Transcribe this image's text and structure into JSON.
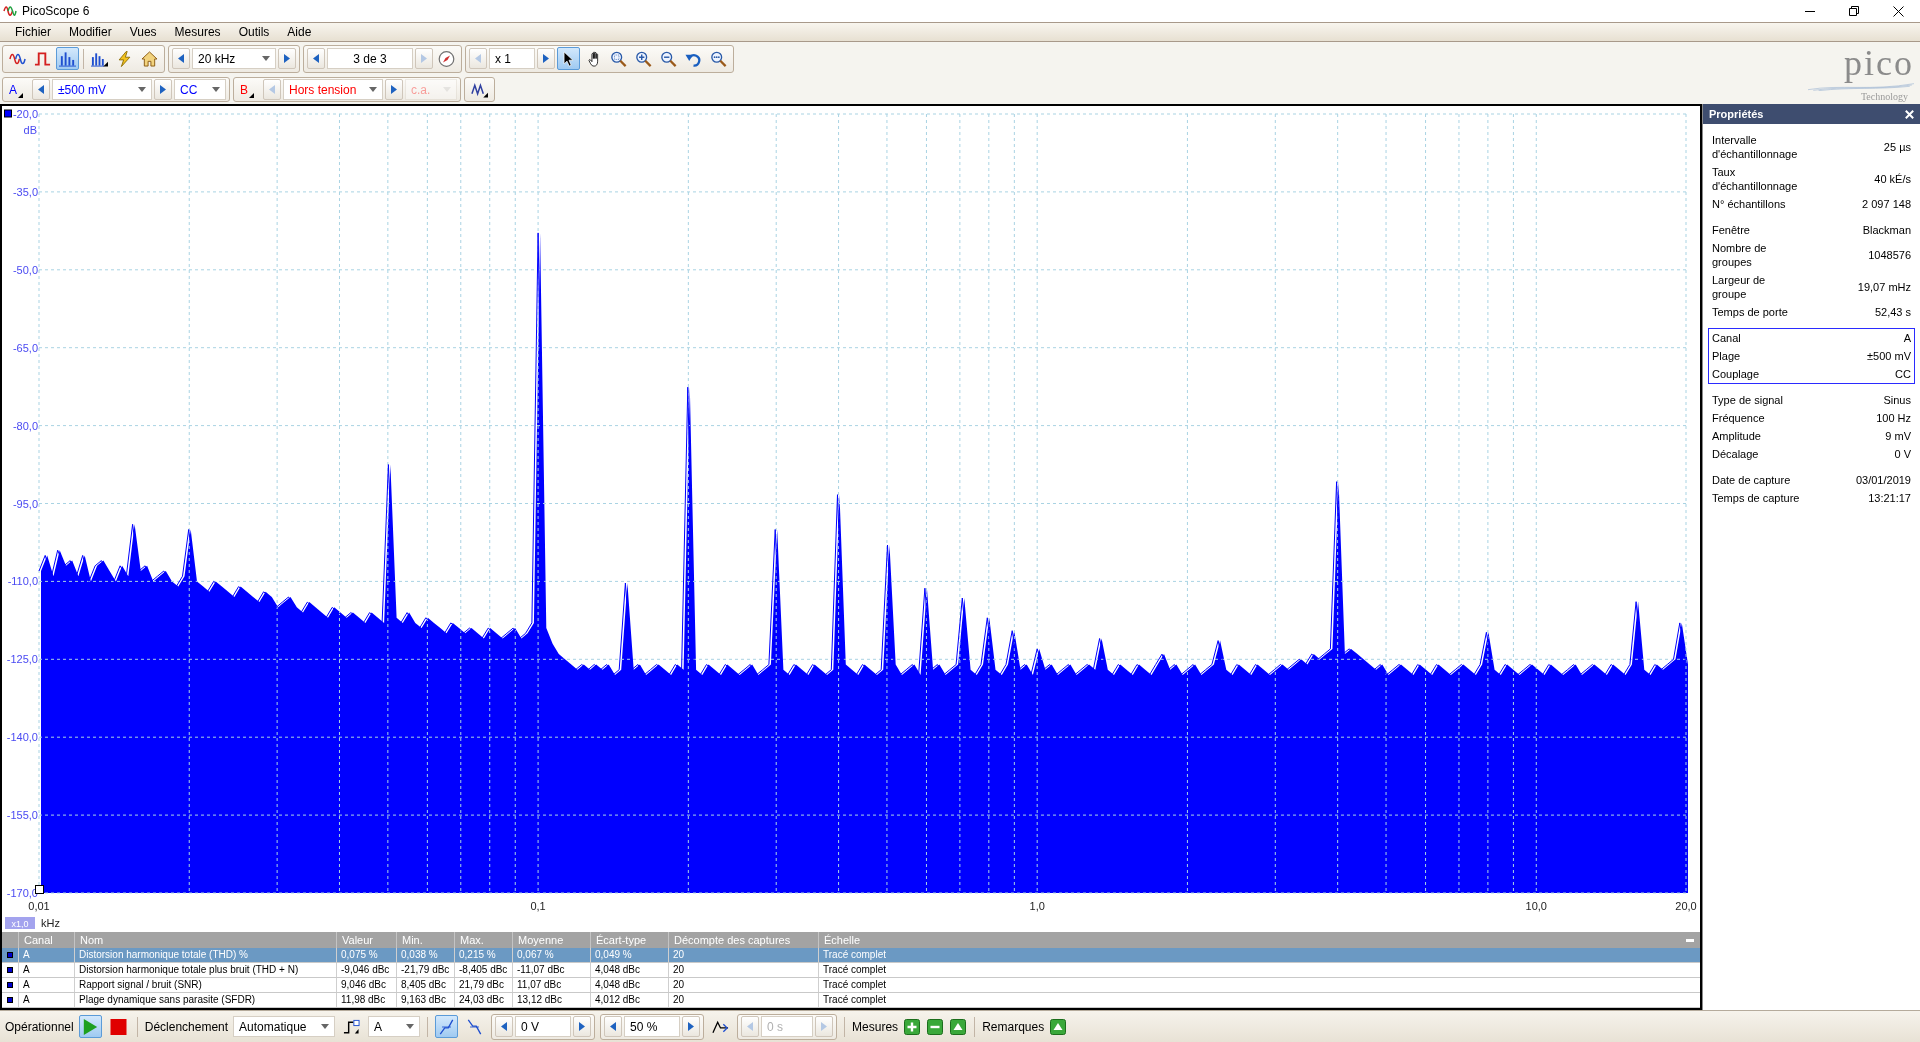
{
  "window": {
    "title": "PicoScope 6"
  },
  "menu": [
    {
      "label": "Fichier"
    },
    {
      "label": "Modifier"
    },
    {
      "label": "Vues"
    },
    {
      "label": "Mesures"
    },
    {
      "label": "Outils"
    },
    {
      "label": "Aide"
    }
  ],
  "toolbar": {
    "modes": [
      {
        "kind": "scope",
        "selected": false
      },
      {
        "kind": "persistence",
        "selected": false
      },
      {
        "kind": "spectrum",
        "selected": true
      }
    ],
    "actions": [
      {
        "kind": "spectrum_options"
      },
      {
        "kind": "auto_setup"
      },
      {
        "kind": "default_setup"
      }
    ],
    "timebase": {
      "value": "20 kHz",
      "prev_disabled": false,
      "next_disabled": false
    },
    "buffer": {
      "value": "3 de 3",
      "prev_disabled": false,
      "next_disabled": true
    },
    "zoom": {
      "value": "x 1",
      "prev_disabled": true,
      "next_disabled": false
    },
    "tools": [
      {
        "kind": "pointer",
        "selected": true
      },
      {
        "kind": "hand",
        "selected": false
      },
      {
        "kind": "zoom_area",
        "selected": false
      },
      {
        "kind": "zoom_in",
        "selected": false
      },
      {
        "kind": "zoom_out",
        "selected": false
      },
      {
        "kind": "undo_zoom",
        "selected": false
      },
      {
        "kind": "zoom_fit",
        "selected": false
      }
    ]
  },
  "channel_bar": {
    "channels": [
      {
        "label": "A",
        "color": "#0000ff",
        "range": {
          "value": "±500 mV",
          "prev_disabled": false,
          "next_disabled": false
        },
        "coupling": {
          "value": "CC",
          "disabled": false
        }
      },
      {
        "label": "B",
        "color": "#ff0000",
        "range": {
          "value": "Hors tension",
          "prev_disabled": true,
          "next_disabled": false
        },
        "coupling": {
          "value": "c.a.",
          "disabled": true
        }
      }
    ]
  },
  "logo": {
    "wordmark": "pico",
    "tagline": "Technology"
  },
  "chart": {
    "zoom_badge": "x1,0",
    "chart_data": {
      "type": "line",
      "xlabel": "kHz",
      "ylabel": "dB",
      "grid": true,
      "categories": [
        "0,01",
        null,
        null,
        null,
        null,
        null,
        null,
        null,
        null,
        null,
        null,
        null,
        null,
        null,
        null,
        null,
        null,
        null,
        null,
        null,
        null,
        null,
        null,
        null,
        null,
        null,
        null,
        null,
        null,
        null,
        null,
        null,
        null,
        null,
        null,
        null,
        null,
        null,
        null,
        null,
        null,
        null,
        null,
        null,
        null,
        null,
        null,
        null,
        null,
        null,
        null,
        null,
        null,
        null,
        null,
        null,
        null,
        null,
        null,
        null,
        null,
        null,
        null,
        null,
        null,
        null,
        null,
        null,
        null,
        null,
        null,
        null,
        null,
        null,
        null,
        null,
        null,
        null,
        null,
        null,
        "0,1",
        null,
        null,
        null,
        null,
        null,
        null,
        null,
        null,
        null,
        null,
        null,
        null,
        null,
        null,
        null,
        null,
        null,
        null,
        null,
        null,
        null,
        null,
        null,
        null,
        null,
        null,
        null,
        null,
        null,
        null,
        null,
        null,
        null,
        null,
        null,
        null,
        null,
        null,
        null,
        null,
        null,
        null,
        null,
        null,
        null,
        null,
        null,
        null,
        null,
        null,
        null,
        null,
        null,
        null,
        null,
        null,
        null,
        null,
        null,
        null,
        null,
        null,
        null,
        null,
        null,
        null,
        null,
        null,
        null,
        null,
        null,
        null,
        null,
        null,
        null,
        null,
        null,
        null,
        null,
        "1,0",
        null,
        null,
        null,
        null,
        null,
        null,
        null,
        null,
        null,
        null,
        null,
        null,
        null,
        null,
        null,
        null,
        null,
        null,
        null,
        null,
        null,
        null,
        null,
        null,
        null,
        null,
        null,
        null,
        null,
        null,
        null,
        null,
        null,
        null,
        null,
        null,
        null,
        null,
        null,
        null,
        null,
        null,
        null,
        null,
        null,
        null,
        null,
        null,
        null,
        null,
        null,
        null,
        null,
        null,
        null,
        null,
        null,
        null,
        null,
        null,
        null,
        null,
        null,
        null,
        null,
        null,
        null,
        null,
        null,
        null,
        null,
        null,
        null,
        null,
        null,
        null,
        null,
        null,
        null,
        "10,0",
        null,
        null,
        null,
        null,
        null,
        null,
        null,
        null,
        null,
        null,
        null,
        null,
        null,
        null,
        null,
        null,
        null,
        null,
        null,
        null,
        null,
        null,
        null,
        "20,0"
      ],
      "series": [
        {
          "color": "#0000ff",
          "values": [
            -108,
            -105,
            -109,
            -104,
            -107,
            -106,
            -109,
            -105,
            -110,
            -107,
            -106,
            -108,
            -110,
            -107,
            -109,
            -99,
            -108,
            -107,
            -110,
            -109,
            -108,
            -110,
            -111,
            -109,
            -100,
            -110,
            -111,
            -112,
            -110,
            -111,
            -112,
            -113,
            -111,
            -112,
            -113,
            -114,
            -112,
            -113,
            -115,
            -114,
            -113,
            -115,
            -116,
            -114,
            -115,
            -116,
            -117,
            -115,
            -116,
            -117,
            -116,
            -117,
            -118,
            -116,
            -117,
            -118,
            -87.5,
            -117,
            -118,
            -116,
            -118,
            -119,
            -117,
            -118,
            -119,
            -120,
            -118,
            -119,
            -120,
            -119,
            -120,
            -121,
            -119,
            -120,
            -121,
            -120,
            -119,
            -121,
            -120,
            -118,
            -42.9,
            -119,
            -122,
            -124,
            -125,
            -126,
            -127,
            -126,
            -127,
            -126,
            -127,
            -126,
            -128,
            -127,
            -110.3,
            -127,
            -126,
            -128,
            -127,
            -126,
            -127,
            -128,
            -126,
            -127,
            -72.6,
            -127,
            -128,
            -126,
            -127,
            -128,
            -126,
            -127,
            -128,
            -127,
            -126,
            -128,
            -127,
            -126,
            -100,
            -127,
            -128,
            -126,
            -127,
            -128,
            -126,
            -127,
            -128,
            -127,
            -93.3,
            -126,
            -127,
            -128,
            -126,
            -127,
            -128,
            -127,
            -103,
            -126,
            -128,
            -127,
            -126,
            -128,
            -111.3,
            -127,
            -126,
            -128,
            -127,
            -126,
            -113.2,
            -127,
            -128,
            -126,
            -117,
            -127,
            -128,
            -126,
            -119.5,
            -127,
            -126,
            -128,
            -123,
            -127,
            -126,
            -128,
            -127,
            -126,
            -128,
            -127,
            -126,
            -127,
            -121,
            -127,
            -128,
            -126,
            -127,
            -128,
            -126,
            -127,
            -128,
            -126,
            -124,
            -127,
            -126,
            -128,
            -127,
            -126,
            -128,
            -127,
            -126,
            -121.4,
            -127,
            -128,
            -126,
            -127,
            -128,
            -126,
            -127,
            -128,
            -127,
            -126,
            -127,
            -126,
            -125,
            -126,
            -124,
            -125,
            -124,
            -123,
            -90.8,
            -124,
            -123,
            -124,
            -125,
            -126,
            -127,
            -126,
            -128,
            -127,
            -126,
            -127,
            -128,
            -126,
            -127,
            -128,
            -126,
            -127,
            -128,
            -127,
            -126,
            -127,
            -128,
            -126,
            -119.8,
            -127,
            -128,
            -126,
            -127,
            -128,
            -127,
            -126,
            -127,
            -128,
            -126,
            -127,
            -128,
            -127,
            -126,
            -128,
            -127,
            -126,
            -127,
            -128,
            -126,
            -127,
            -128,
            -126,
            -113.9,
            -127,
            -128,
            -126,
            -127,
            -126,
            -125,
            -118,
            -126
          ]
        }
      ],
      "ylim": [
        -170,
        -20
      ],
      "yticks": [
        {
          "value": -20,
          "label": "-20,0"
        },
        {
          "value": -35,
          "label": "-35,0"
        },
        {
          "value": -50,
          "label": "-50,0"
        },
        {
          "value": -65,
          "label": "-65,0"
        },
        {
          "value": -80,
          "label": "-80,0"
        },
        {
          "value": -95,
          "label": "-95,0"
        },
        {
          "value": -110,
          "label": "-110,0"
        },
        {
          "value": -125,
          "label": "-125,0"
        },
        {
          "value": -140,
          "label": "-140,0"
        },
        {
          "value": -155,
          "label": "-155,0"
        },
        {
          "value": -170,
          "label": "-170,0"
        }
      ]
    }
  },
  "measurements": {
    "columns": [
      "Canal",
      "Nom",
      "Valeur",
      "Min.",
      "Max.",
      "Moyenne",
      "Écart-type",
      "Décompte des captures",
      "Échelle"
    ],
    "rows": [
      {
        "selected": true,
        "cells": [
          "A",
          "Distorsion harmonique totale (THD) %",
          "0,075 %",
          "0,038 %",
          "0,215 %",
          "0,067 %",
          "0,049 %",
          "20",
          "Tracé complet"
        ]
      },
      {
        "selected": false,
        "cells": [
          "A",
          "Distorsion harmonique totale plus bruit (THD + N)",
          "-9,046 dBc",
          "-21,79 dBc",
          "-8,405 dBc",
          "-11,07 dBc",
          "4,048 dBc",
          "20",
          "Tracé complet"
        ]
      },
      {
        "selected": false,
        "cells": [
          "A",
          "Rapport signal / bruit (SNR)",
          "9,046 dBc",
          "8,405 dBc",
          "21,79 dBc",
          "11,07 dBc",
          "4,048 dBc",
          "20",
          "Tracé complet"
        ]
      },
      {
        "selected": false,
        "cells": [
          "A",
          "Plage dynamique sans parasite (SFDR)",
          "11,98 dBc",
          "9,163 dBc",
          "24,03 dBc",
          "13,12 dBc",
          "4,012 dBc",
          "20",
          "Tracé complet"
        ]
      }
    ]
  },
  "properties": {
    "title": "Propriétés",
    "groups": [
      {
        "highlighted": false,
        "rows": [
          {
            "label": "Intervalle\nd'échantillonnage",
            "value": "25 µs"
          },
          {
            "label": "Taux\nd'échantillonnage",
            "value": "40 kÉ/s"
          },
          {
            "label": "N° échantillons",
            "value": "2 097 148"
          }
        ]
      },
      {
        "highlighted": false,
        "rows": [
          {
            "label": "Fenêtre",
            "value": "Blackman"
          },
          {
            "label": "Nombre de\ngroupes",
            "value": "1048576"
          },
          {
            "label": "Largeur de\ngroupe",
            "value": "19,07 mHz"
          },
          {
            "label": "Temps de porte",
            "value": "52,43 s"
          }
        ]
      },
      {
        "highlighted": true,
        "rows": [
          {
            "label": "Canal",
            "value": "A"
          },
          {
            "label": "Plage",
            "value": "±500 mV"
          },
          {
            "label": "Couplage",
            "value": "CC"
          }
        ]
      },
      {
        "highlighted": false,
        "rows": [
          {
            "label": "Type de signal",
            "value": "Sinus"
          },
          {
            "label": "Fréquence",
            "value": "100 Hz"
          },
          {
            "label": "Amplitude",
            "value": "9 mV"
          },
          {
            "label": "Décalage",
            "value": "0 V"
          }
        ]
      },
      {
        "highlighted": false,
        "rows": [
          {
            "label": "Date de capture",
            "value": "03/01/2019"
          },
          {
            "label": "Temps de capture",
            "value": "13:21:17"
          }
        ]
      }
    ]
  },
  "status_bar": {
    "state": {
      "label": "Opérationnel",
      "running": true
    },
    "trigger": {
      "label": "Déclenchement",
      "mode": "Automatique",
      "source": "A",
      "edges": [
        {
          "kind": "rising",
          "selected": true
        },
        {
          "kind": "falling",
          "selected": false
        }
      ],
      "level": {
        "value": "0 V",
        "prev_disabled": false,
        "next_disabled": false
      },
      "pretrigger": {
        "value": "50 %",
        "prev_disabled": false,
        "next_disabled": false
      },
      "delay": {
        "value": "0 s",
        "disabled": true
      }
    },
    "measurements_label": "Mesures",
    "notes_label": "Remarques"
  }
}
